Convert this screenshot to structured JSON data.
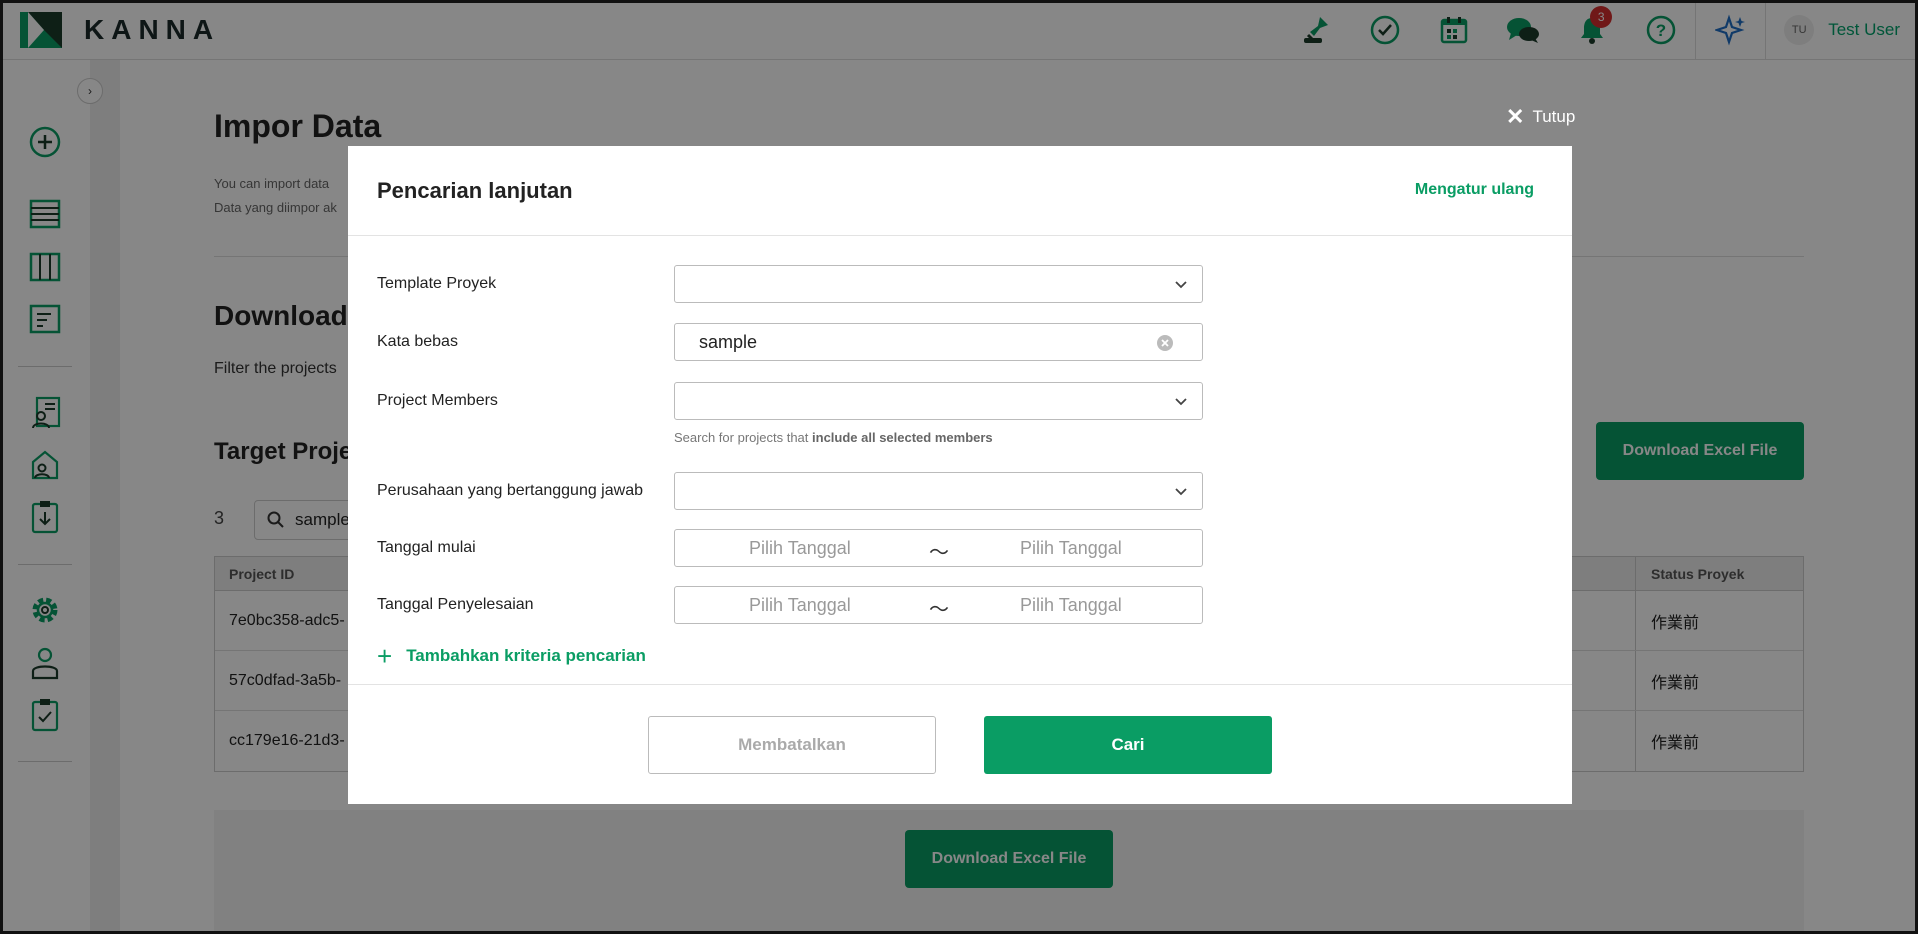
{
  "app": {
    "logo_text": "KANNA",
    "accent": "#0a9d64"
  },
  "topbar": {
    "icons": [
      "stamp-icon",
      "check-circle-icon",
      "calendar-icon",
      "chat-icon",
      "bell-icon",
      "help-icon",
      "sparkle-icon"
    ],
    "notification_count": "3",
    "user": {
      "initials": "TU",
      "name": "Test User"
    }
  },
  "sidebar": {
    "icons": [
      "add-circle-icon",
      "list-icon",
      "board-icon",
      "document-icon",
      "contact-list-icon",
      "house-user-icon",
      "clipboard-download-icon",
      "gear-icon",
      "user-icon",
      "clipboard-check-icon"
    ]
  },
  "page": {
    "title": "Impor Data",
    "desc_line1": "You can import data",
    "desc_line2": "Data yang diimpor ak",
    "section_title": "Download",
    "section_desc": "Filter the projects",
    "target_title": "Target Proje",
    "download_button": "Download Excel File",
    "result_count": "3",
    "search_value": "sample",
    "table": {
      "col_project_id": "Project ID",
      "col_status": "Status Proyek",
      "rows": [
        {
          "id": "7e0bc358-adc5-",
          "status": "作業前"
        },
        {
          "id": "57c0dfad-3a5b-",
          "status": "作業前"
        },
        {
          "id": "cc179e16-21d3-",
          "status": "作業前"
        }
      ]
    }
  },
  "modal": {
    "close_label": "Tutup",
    "title": "Pencarian lanjutan",
    "reset_label": "Mengatur ulang",
    "fields": {
      "template": {
        "label": "Template Proyek",
        "value": ""
      },
      "keyword": {
        "label": "Kata bebas",
        "value": "sample"
      },
      "members": {
        "label": "Project Members",
        "value": ""
      },
      "members_hint_prefix": "Search for projects that ",
      "members_hint_bold": "include all selected members",
      "company": {
        "label": "Perusahaan yang bertanggung jawab",
        "value": ""
      },
      "start_date": {
        "label": "Tanggal mulai",
        "from_placeholder": "Pilih Tanggal",
        "to_placeholder": "Pilih Tanggal",
        "separator": "〜"
      },
      "end_date": {
        "label": "Tanggal Penyelesaian",
        "from_placeholder": "Pilih Tanggal",
        "to_placeholder": "Pilih Tanggal",
        "separator": "〜"
      }
    },
    "add_criteria_label": "Tambahkan kriteria pencarian",
    "cancel_label": "Membatalkan",
    "search_label": "Cari"
  }
}
